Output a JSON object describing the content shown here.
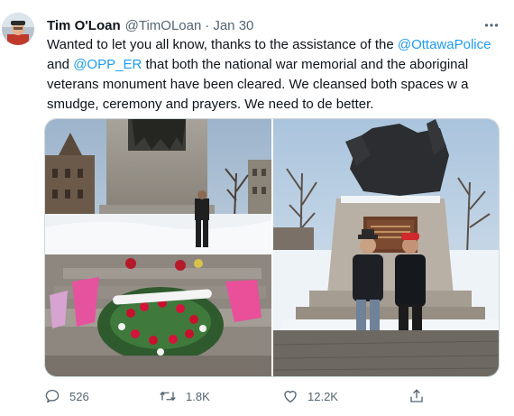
{
  "tweet": {
    "author_name": "Tim O'Loan",
    "author_handle": "@TimOLoan",
    "separator": "·",
    "date": "Jan 30",
    "text": {
      "line1_prefix": "Wanted to let you all know, thanks to the assistance of the ",
      "line1_mention": "@OttawaPolice",
      "line2_prefix": "and ",
      "line2_mention": "@OPP_ER",
      "line2_suffix": " that both the national war memorial and the aboriginal",
      "line3": "veterans monument have been cleared. We cleansed both spaces w a",
      "line4": "smudge, ceremony and prayers. We need to de better."
    },
    "media": [
      {
        "icon": "photo-national-war-memorial"
      },
      {
        "icon": "photo-aboriginal-veterans-monument"
      }
    ],
    "actions": {
      "reply": {
        "icon": "reply-icon",
        "count": "526"
      },
      "retweet": {
        "icon": "retweet-icon",
        "count": "1.8K"
      },
      "like": {
        "icon": "heart-icon",
        "count": "12.2K"
      },
      "share": {
        "icon": "share-icon"
      }
    },
    "colors": {
      "text": "#0f1419",
      "secondary": "#536471",
      "link": "#1d9bf0",
      "border": "#cfd9de"
    }
  }
}
